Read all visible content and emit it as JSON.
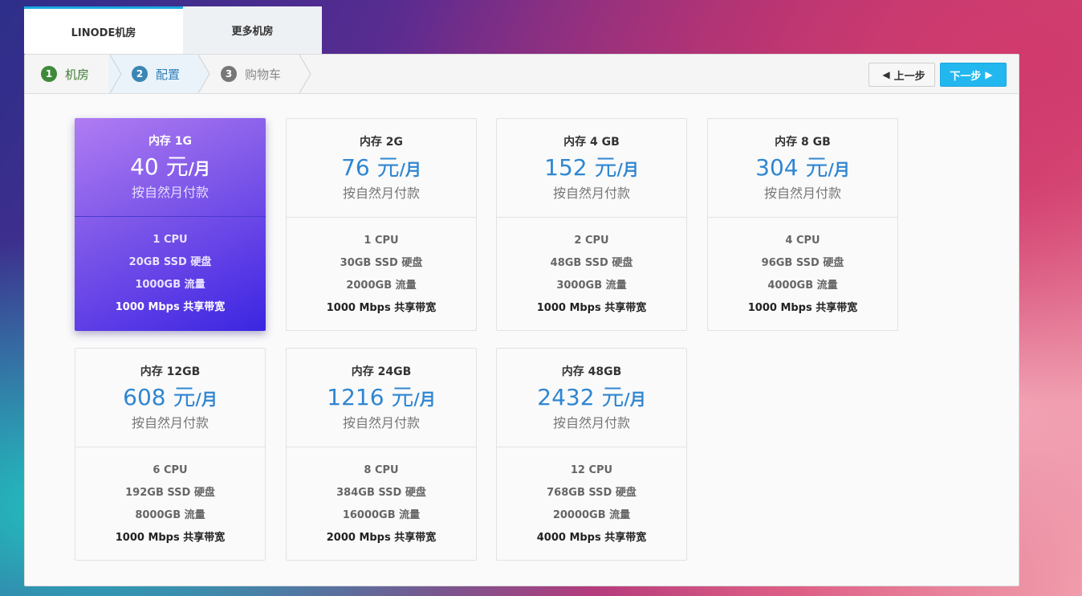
{
  "tabs": [
    {
      "label": "LINODE机房",
      "active": true
    },
    {
      "label": "更多机房",
      "active": false
    }
  ],
  "steps": [
    {
      "num": "1",
      "label": "机房"
    },
    {
      "num": "2",
      "label": "配置"
    },
    {
      "num": "3",
      "label": "购物车"
    }
  ],
  "buttons": {
    "prev_label": "上一步",
    "next_label": "下一步",
    "prev_icon": "arrow-left-icon",
    "next_icon": "arrow-right-icon"
  },
  "colors": {
    "accent": "#22b7ee",
    "price": "#2f86d1",
    "selected_card": "#5a3ae6"
  },
  "plans": [
    {
      "memory": "内存 1G",
      "price": "40 元",
      "unit": "/月",
      "billing": "按自然月付款",
      "cpu": "1 CPU",
      "disk": "20GB SSD 硬盘",
      "traffic": "1000GB 流量",
      "bandwidth": "1000 Mbps 共享带宽",
      "selected": true
    },
    {
      "memory": "内存 2G",
      "price": "76 元",
      "unit": "/月",
      "billing": "按自然月付款",
      "cpu": "1 CPU",
      "disk": "30GB SSD 硬盘",
      "traffic": "2000GB 流量",
      "bandwidth": "1000 Mbps 共享带宽",
      "selected": false
    },
    {
      "memory": "内存 4 GB",
      "price": "152 元",
      "unit": "/月",
      "billing": "按自然月付款",
      "cpu": "2 CPU",
      "disk": "48GB SSD 硬盘",
      "traffic": "3000GB 流量",
      "bandwidth": "1000 Mbps 共享带宽",
      "selected": false
    },
    {
      "memory": "内存 8 GB",
      "price": "304 元",
      "unit": "/月",
      "billing": "按自然月付款",
      "cpu": "4 CPU",
      "disk": "96GB SSD 硬盘",
      "traffic": "4000GB 流量",
      "bandwidth": "1000 Mbps 共享带宽",
      "selected": false
    },
    {
      "memory": "内存 12GB",
      "price": "608 元",
      "unit": "/月",
      "billing": "按自然月付款",
      "cpu": "6 CPU",
      "disk": "192GB SSD 硬盘",
      "traffic": "8000GB 流量",
      "bandwidth": "1000 Mbps 共享带宽",
      "selected": false
    },
    {
      "memory": "内存 24GB",
      "price": "1216 元",
      "unit": "/月",
      "billing": "按自然月付款",
      "cpu": "8 CPU",
      "disk": "384GB SSD 硬盘",
      "traffic": "16000GB 流量",
      "bandwidth": "2000 Mbps 共享带宽",
      "selected": false
    },
    {
      "memory": "内存 48GB",
      "price": "2432 元",
      "unit": "/月",
      "billing": "按自然月付款",
      "cpu": "12 CPU",
      "disk": "768GB SSD 硬盘",
      "traffic": "20000GB 流量",
      "bandwidth": "4000 Mbps 共享带宽",
      "selected": false
    }
  ]
}
